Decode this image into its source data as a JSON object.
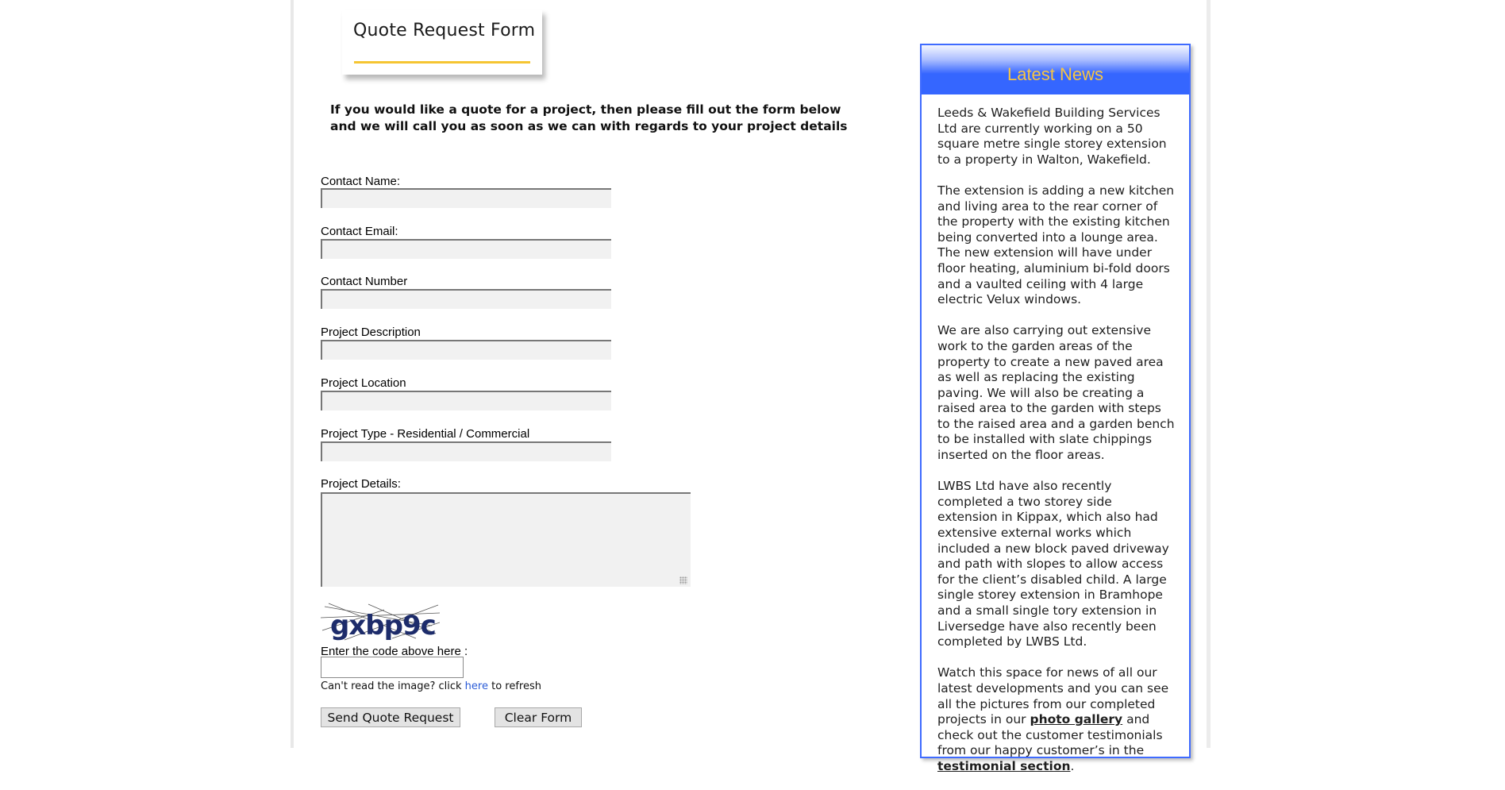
{
  "header": {
    "title": "Quote Request Form"
  },
  "intro": "If you would like a quote for a project, then please fill out the form below and we will call you as soon as we can with regards to your project details",
  "form": {
    "fields": [
      {
        "label": "Contact Name:",
        "value": ""
      },
      {
        "label": "Contact Email:",
        "value": ""
      },
      {
        "label": "Contact Number",
        "value": ""
      },
      {
        "label": "Project Description",
        "value": ""
      },
      {
        "label": "Project Location",
        "value": ""
      },
      {
        "label": "Project Type - Residential / Commercial",
        "value": ""
      }
    ],
    "details_label": "Project Details:",
    "details_value": "",
    "captcha_code": "gxbp9c",
    "captcha_label": "Enter the code above here :",
    "captcha_value": "",
    "refresh_prefix": "Can't read the image? click ",
    "refresh_link": "here",
    "refresh_suffix": " to refresh",
    "send_label": "Send Quote Request",
    "clear_label": "Clear Form"
  },
  "news": {
    "title": "Latest News",
    "paragraphs": [
      "Leeds & Wakefield Building Services Ltd are currently working on a 50 square metre single storey extension to a property in Walton, Wakefield.",
      "The extension is adding a new kitchen and living area to the rear corner of the property with the existing kitchen being converted into a lounge area. The new extension will have under floor heating, aluminium bi-fold doors and a vaulted ceiling with 4 large electric Velux windows.",
      "We are also carrying out extensive work to the garden areas of the property to create a new paved area as well as replacing the existing paving. We will also be creating a raised area to the garden with steps to the raised area and a garden bench to be installed with slate chippings inserted on the floor areas.",
      "LWBS Ltd have also recently completed a two storey side extension in Kippax, which also had extensive external works which included a new block paved driveway and path with slopes to allow access for the client’s disabled child. A large single storey extension in Bramhope and a small single tory extension in Liversedge have also recently been completed by LWBS Ltd."
    ],
    "last_paragraph": {
      "part1": "Watch this space for news of all our latest developments and you can see all the pictures from our completed projects in our ",
      "link1": "photo gallery",
      "part2": " and check out the customer testimonials from our happy customer’s in the ",
      "link2": "testimonial section",
      "part3": "."
    }
  },
  "colors": {
    "news_border": "#3f6bff",
    "news_header": "#3566ff",
    "news_title": "#f7c544",
    "title_underline": "#f5c532",
    "link": "#2a5bd7"
  }
}
